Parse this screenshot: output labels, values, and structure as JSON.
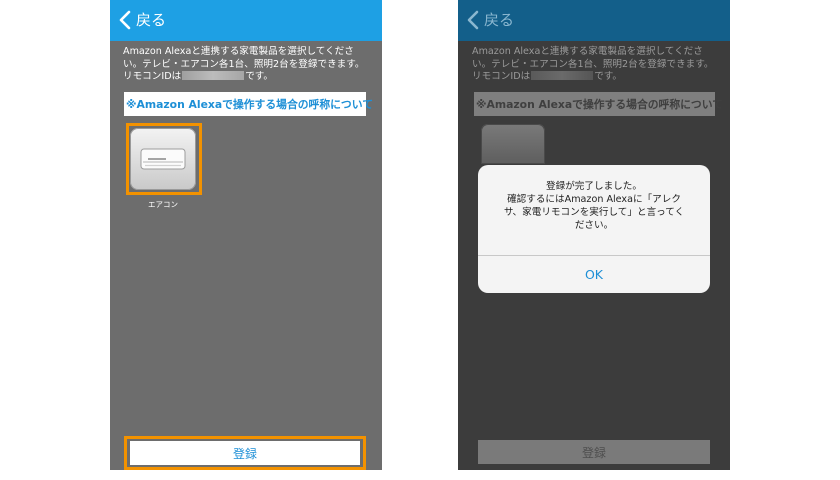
{
  "nav": {
    "back_label": "戻る"
  },
  "description": {
    "line1": "Amazon Alexaと連携する家電製品を選択してくださ",
    "line2": "い。テレビ・エアコン各1台、照明2台を登録できます。",
    "line3_prefix": "リモコンIDは",
    "line3_suffix": "です。"
  },
  "alexa_link": "※Amazon Alexaで操作する場合の呼称について",
  "device": {
    "label": "エアコン",
    "icon": "air-conditioner-icon"
  },
  "register_label": "登録",
  "dialog": {
    "line1": "登録が完了しました。",
    "line2": "確認するにはAmazon Alexaに「アレク",
    "line3": "サ、家電リモコンを実行して」と言ってく",
    "line4": "ださい。",
    "ok_label": "OK"
  },
  "colors": {
    "nav_blue": "#1ea0e4",
    "highlight_orange": "#f39200",
    "link_blue": "#1d8fd6"
  }
}
